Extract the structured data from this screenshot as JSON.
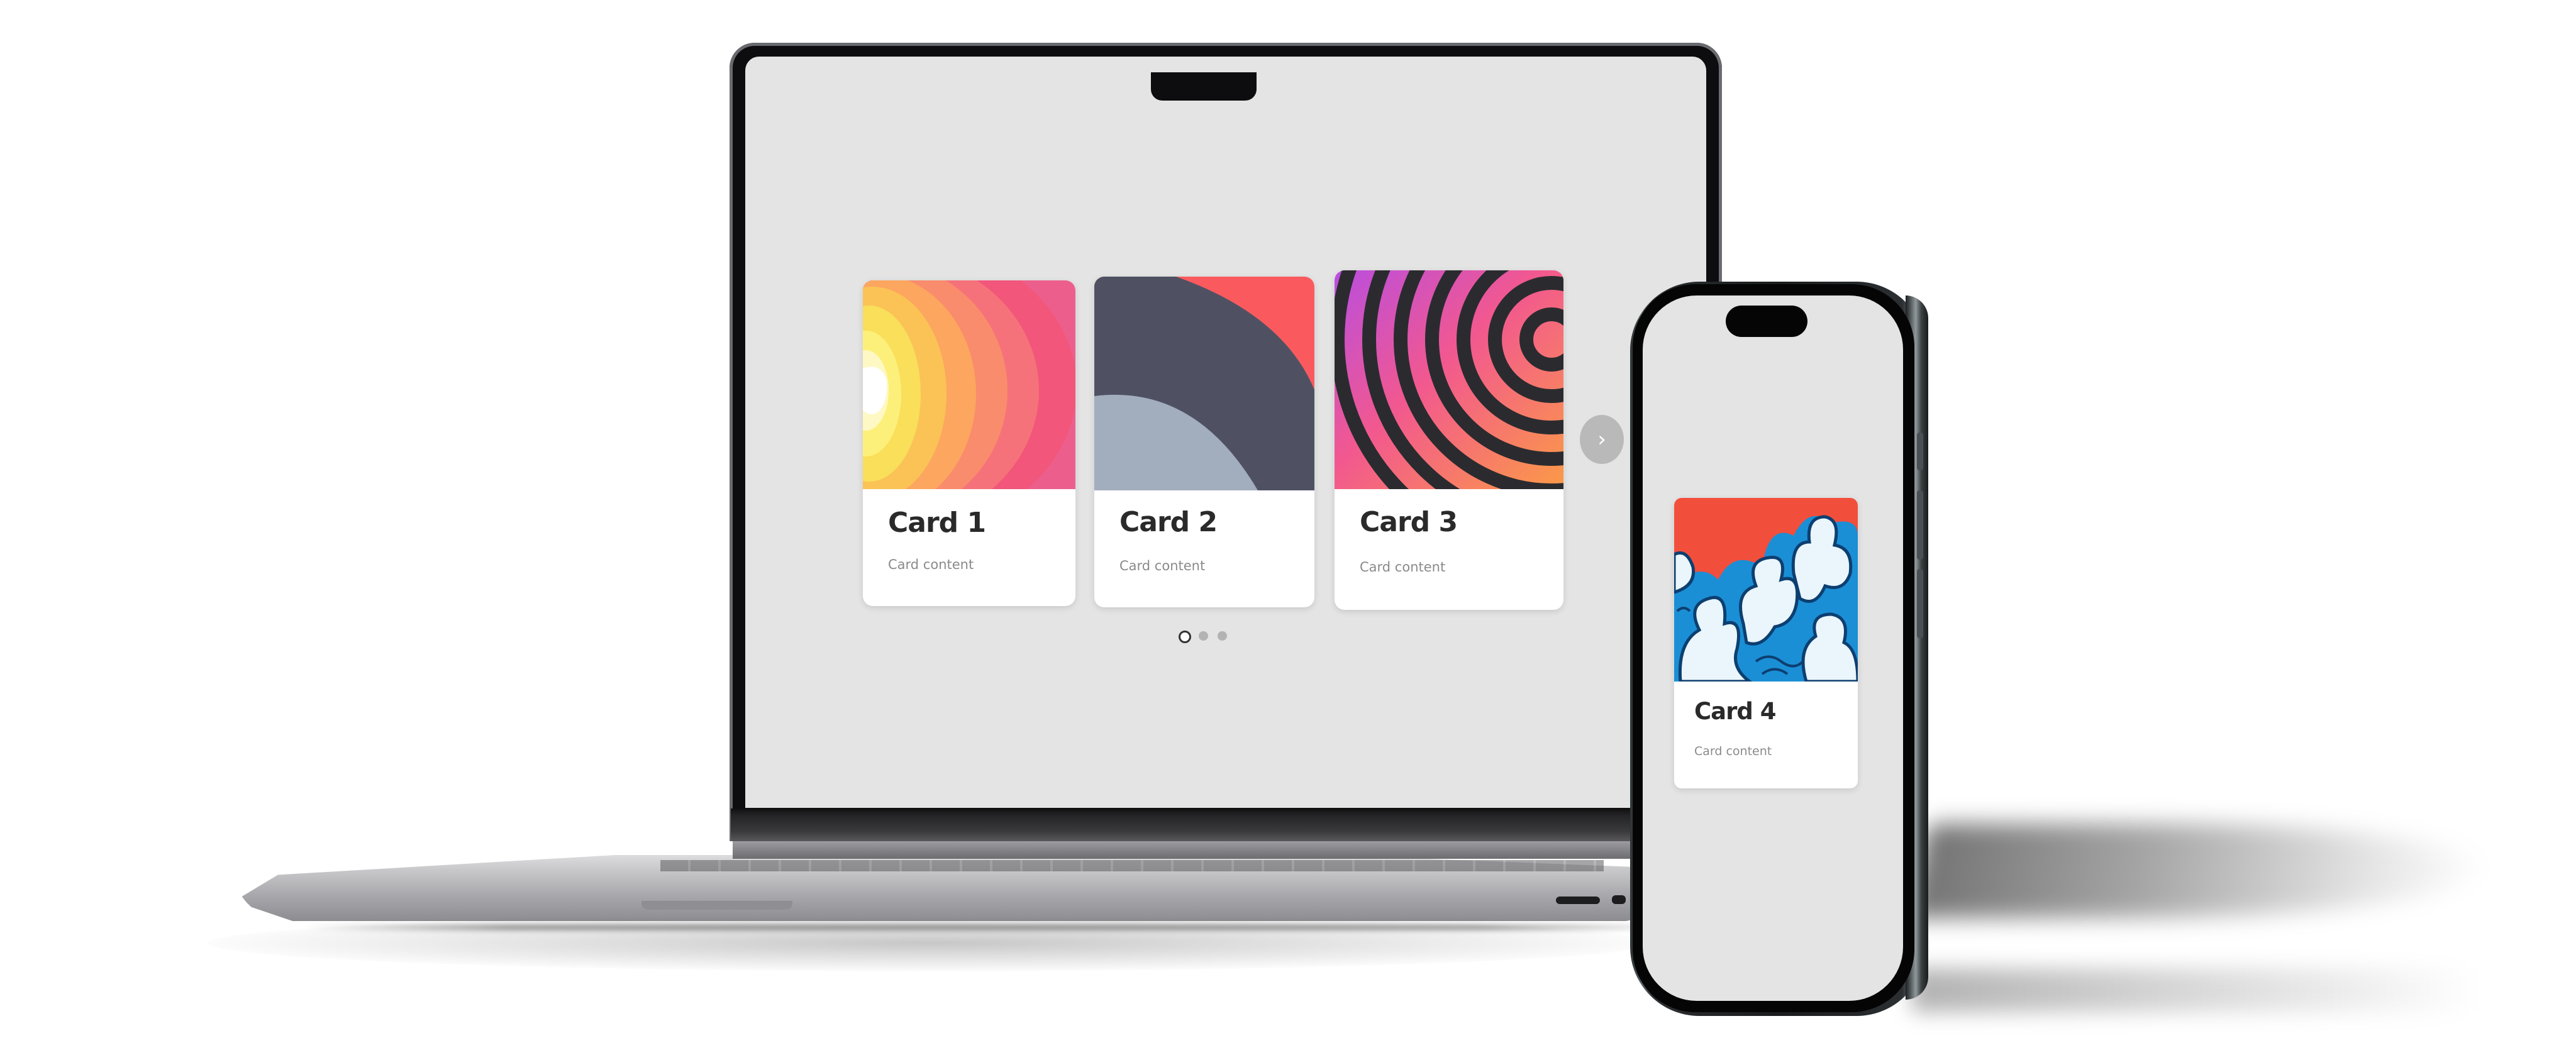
{
  "carousel": {
    "cards": [
      {
        "title": "Card 1",
        "content": "Card content"
      },
      {
        "title": "Card 2",
        "content": "Card content"
      },
      {
        "title": "Card 3",
        "content": "Card content"
      }
    ],
    "next_icon": "chevron-right-icon",
    "next_label": "›",
    "pagination": {
      "count": 3,
      "active_index": 0
    }
  },
  "phone_carousel": {
    "cards": [
      {
        "title": "Card 4",
        "content": "Card content"
      }
    ]
  },
  "colors": {
    "screen_background": "#e4e4e4",
    "card_background": "#ffffff",
    "title_color": "#2a2a2a",
    "content_color": "#8a8a8a",
    "button_background": "#b9b9b9"
  }
}
